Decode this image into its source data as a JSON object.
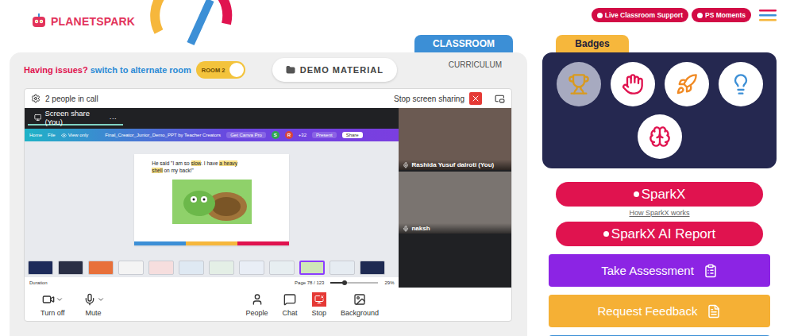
{
  "logo": {
    "text": "PLANETSPARK"
  },
  "header": {
    "buttons": [
      {
        "label": "Live Classroom Support"
      },
      {
        "label": "PS Moments"
      }
    ]
  },
  "tabs": [
    {
      "label": "CLASSROOM",
      "selected": true
    },
    {
      "label": "CURRICULUM",
      "selected": false
    }
  ],
  "room_switch": {
    "prompt": "Having issues?",
    "link": "switch to alternate room",
    "toggle_label": "ROOM 2",
    "on": true
  },
  "demo_button": {
    "label": "DEMO MATERIAL"
  },
  "call": {
    "people": "2 people in call",
    "stop_share": "Stop screen sharing",
    "share_tab": "Screen share (You)",
    "share_more": "···",
    "participants": [
      {
        "name": "Rashida Yusuf dalroti (You)"
      },
      {
        "name": "naksh"
      }
    ],
    "controls": [
      {
        "label": "Turn off",
        "kind": "device",
        "alert": false
      },
      {
        "label": "Mute",
        "kind": "device",
        "alert": false
      },
      {
        "label": "People",
        "kind": "action",
        "alert": false
      },
      {
        "label": "Chat",
        "kind": "action",
        "alert": false
      },
      {
        "label": "Stop",
        "kind": "action",
        "alert": true
      },
      {
        "label": "Background",
        "kind": "action",
        "alert": false
      }
    ]
  },
  "shared_window": {
    "menu": [
      "Home",
      "File",
      "View only"
    ],
    "title": "Final_Creator_Junior_Demo_PPT by Teacher Creators",
    "pro": "Get Canva Pro",
    "avatars": [
      {
        "letter": "S",
        "color": "#2fa84f"
      },
      {
        "letter": "R",
        "color": "#d8453b"
      }
    ],
    "extra_count": "+32",
    "present": "Present",
    "share": "Share",
    "slide": {
      "segments": [
        {
          "text": "He said \"I am so ",
          "highlight": false
        },
        {
          "text": "slow",
          "highlight": true
        },
        {
          "text": ". I have ",
          "highlight": false
        },
        {
          "text": "a heavy shell",
          "highlight": true
        },
        {
          "text": " on my back!\"",
          "highlight": false
        }
      ]
    },
    "thumbnails": [
      {
        "color": "#1d2b5a",
        "selected": false
      },
      {
        "color": "#2a2f45",
        "selected": false
      },
      {
        "color": "#e8703a",
        "selected": false
      },
      {
        "color": "#f4f4f4",
        "selected": false
      },
      {
        "color": "#f6dede",
        "selected": false
      },
      {
        "color": "#dfe9f3",
        "selected": false
      },
      {
        "color": "#e4efe6",
        "selected": false
      },
      {
        "color": "#e9eef6",
        "selected": false
      },
      {
        "color": "#e7eef1",
        "selected": false
      },
      {
        "color": "#cfe6b8",
        "selected": true
      },
      {
        "color": "#e6ecf2",
        "selected": false
      },
      {
        "color": "#1e2a52",
        "selected": false
      }
    ],
    "duration": "Duration",
    "page": "Page 78 / 123",
    "zoom": "29%",
    "zoom_level": 0.3
  },
  "badges": {
    "title": "Badges",
    "items": [
      {
        "highlighted": true
      },
      {
        "highlighted": false
      },
      {
        "highlighted": false
      },
      {
        "highlighted": false
      },
      {
        "highlighted": false
      }
    ]
  },
  "actions": [
    {
      "label": "SparkX",
      "kind": "pill",
      "color": "#e0134f"
    },
    {
      "label": "How SparkX works",
      "kind": "link",
      "color": "#666666"
    },
    {
      "label": "SparkX AI Report",
      "kind": "pill",
      "color": "#e0134f"
    },
    {
      "label": "Take Assessment",
      "kind": "block",
      "color": "#8c24e4"
    },
    {
      "label": "Request Feedback",
      "kind": "block",
      "color": "#f5b035"
    },
    {
      "label": "",
      "kind": "block",
      "color": "#3b8fd6"
    }
  ]
}
